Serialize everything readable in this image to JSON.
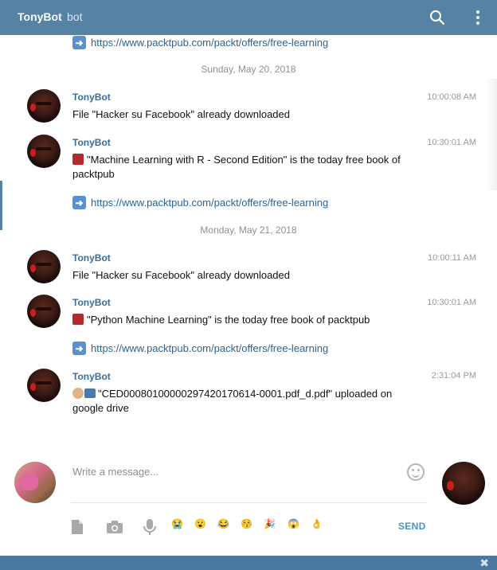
{
  "header": {
    "title": "TonyBot",
    "subtitle": "bot"
  },
  "chat": {
    "top_link": "https://www.packtpub.com/packt/offers/free-learning",
    "dates": [
      "Sunday, May 20, 2018",
      "Monday, May 21, 2018"
    ],
    "messages": [
      {
        "author": "TonyBot",
        "time": "10:00:08 AM",
        "text": "File \"Hacker su Facebook\" already downloaded"
      },
      {
        "author": "TonyBot",
        "time": "10:30:01 AM",
        "text": "\"Machine Learning with R - Second Edition\" is the today free book of packtpub",
        "link": "https://www.packtpub.com/packt/offers/free-learning"
      },
      {
        "author": "TonyBot",
        "time": "10:00:11 AM",
        "text": "File \"Hacker su Facebook\" already downloaded"
      },
      {
        "author": "TonyBot",
        "time": "10:30:01 AM",
        "text": "\"Python Machine Learning\" is the today free book of packtpub",
        "link": "https://www.packtpub.com/packt/offers/free-learning"
      },
      {
        "author": "TonyBot",
        "time": "2:31:04 PM",
        "text": "\"CED00080100000297420170614-0001.pdf_d.pdf\" uploaded on google drive"
      }
    ]
  },
  "composer": {
    "placeholder": "Write a message...",
    "send_label": "SEND",
    "quick_emojis": [
      "😭",
      "😮",
      "😂",
      "😚",
      "🎉",
      "😱",
      "👌"
    ]
  },
  "icons": {
    "search": "search-icon",
    "more": "more-vertical-icon",
    "attach": "document-icon",
    "photo": "camera-icon",
    "voice": "microphone-icon",
    "emoji": "smile-icon",
    "close": "close-icon"
  },
  "colors": {
    "header_bg": "#5682a3",
    "link": "#2a6496",
    "author": "#3a6d99",
    "send": "#4a90c8"
  }
}
